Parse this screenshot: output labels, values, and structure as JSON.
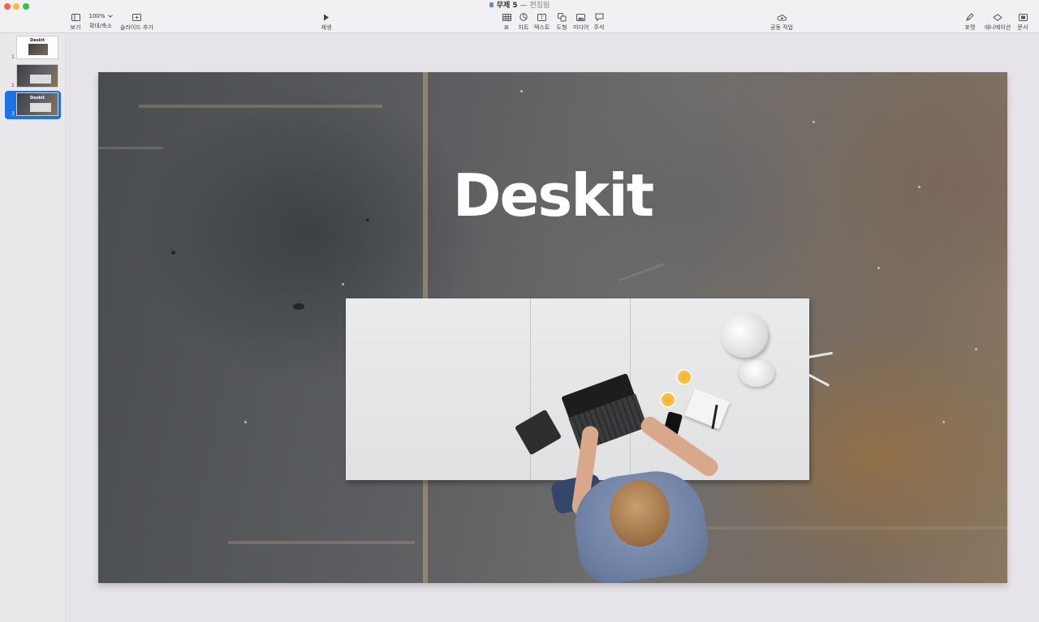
{
  "window": {
    "doc_name": "무제 5",
    "separator": "—",
    "status": "편집됨"
  },
  "toolbar": {
    "view_label": "보기",
    "zoom_value": "100%",
    "zoom_label": "확대/축소",
    "add_slide_label": "슬라이드 추가",
    "play_label": "재생",
    "table_label": "표",
    "chart_label": "차트",
    "text_label": "텍스트",
    "shape_label": "도형",
    "media_label": "미디어",
    "comment_label": "주석",
    "collaborate_label": "공동 작업",
    "format_label": "포맷",
    "animate_label": "애니메이션",
    "document_label": "문서"
  },
  "sidebar": {
    "slides": [
      {
        "number": "1",
        "thumb_title": "Deskit"
      },
      {
        "number": "2",
        "thumb_title": ""
      },
      {
        "number": "3",
        "thumb_title": "Deskit",
        "selected": true
      }
    ]
  },
  "slide": {
    "title": "Deskit"
  },
  "colors": {
    "selection": "#1e72e8",
    "close": "#fe5f57",
    "minimize": "#febc2e",
    "maximize": "#28c840"
  }
}
